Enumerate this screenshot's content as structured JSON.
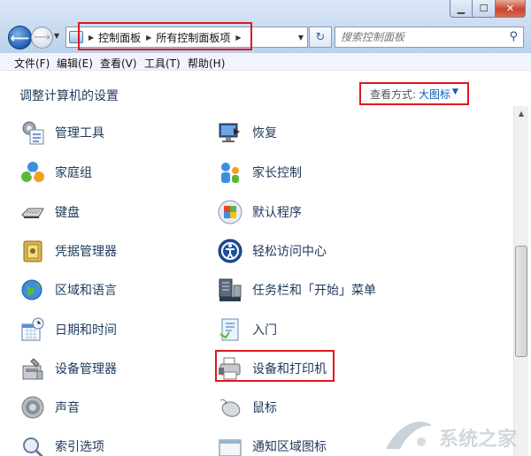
{
  "window": {
    "controls": [
      "minimize-icon",
      "maximize-icon",
      "close-icon"
    ]
  },
  "address": {
    "breadcrumbs": [
      "控制面板",
      "所有控制面板项"
    ]
  },
  "search": {
    "placeholder": "搜索控制面板"
  },
  "menu": [
    "文件(F)",
    "编辑(E)",
    "查看(V)",
    "工具(T)",
    "帮助(H)"
  ],
  "content": {
    "heading": "调整计算机的设置",
    "view_by_label": "查看方式:",
    "view_by_value": "大图标"
  },
  "items": [
    {
      "label": "管理工具",
      "icon": "admin-tools-icon"
    },
    {
      "label": "恢复",
      "icon": "recovery-icon"
    },
    {
      "label": "家庭组",
      "icon": "homegroup-icon"
    },
    {
      "label": "家长控制",
      "icon": "parental-controls-icon"
    },
    {
      "label": "键盘",
      "icon": "keyboard-icon"
    },
    {
      "label": "默认程序",
      "icon": "default-programs-icon"
    },
    {
      "label": "凭据管理器",
      "icon": "credential-manager-icon"
    },
    {
      "label": "轻松访问中心",
      "icon": "ease-of-access-icon"
    },
    {
      "label": "区域和语言",
      "icon": "region-language-icon"
    },
    {
      "label": "任务栏和「开始」菜单",
      "icon": "taskbar-start-menu-icon"
    },
    {
      "label": "日期和时间",
      "icon": "date-time-icon"
    },
    {
      "label": "入门",
      "icon": "getting-started-icon"
    },
    {
      "label": "设备管理器",
      "icon": "device-manager-icon"
    },
    {
      "label": "设备和打印机",
      "icon": "devices-printers-icon"
    },
    {
      "label": "声音",
      "icon": "sound-icon"
    },
    {
      "label": "鼠标",
      "icon": "mouse-icon"
    },
    {
      "label": "索引选项",
      "icon": "indexing-options-icon"
    },
    {
      "label": "通知区域图标",
      "icon": "notification-area-icons-icon"
    }
  ],
  "colors": {
    "highlight": "#e0161e",
    "link": "#1e395b",
    "view_link": "#0b5ab5"
  },
  "watermark": {
    "text": "系统之家"
  }
}
